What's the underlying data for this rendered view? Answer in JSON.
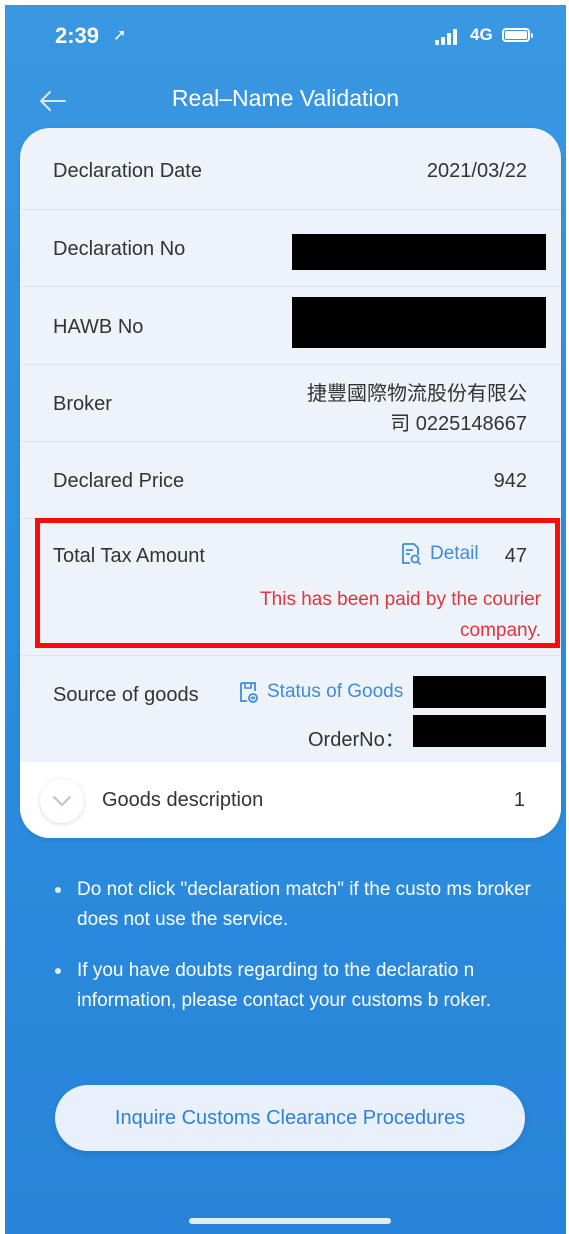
{
  "status_bar": {
    "time": "2:39",
    "network": "4G"
  },
  "header": {
    "title": "Real–Name Validation"
  },
  "details": {
    "declaration_date": {
      "label": "Declaration Date",
      "value": "2021/03/22"
    },
    "declaration_no": {
      "label": "Declaration No"
    },
    "hawb_no": {
      "label": "HAWB No"
    },
    "broker": {
      "label": "Broker",
      "value_line1": "捷豐國際物流股份有限公",
      "value_line2": "司 0225148667"
    },
    "declared_price": {
      "label": "Declared Price",
      "value": "942"
    },
    "total_tax": {
      "label": "Total Tax Amount",
      "detail_link": "Detail",
      "value": "47",
      "note_line1": "This has been paid by the courier",
      "note_line2": "company."
    },
    "source_of_goods": {
      "label": "Source of goods",
      "status_link": "Status of Goods",
      "order_label": "OrderNo："
    },
    "goods_description": {
      "label": "Goods description",
      "count": "1"
    }
  },
  "notes": [
    "Do not click \"declaration match\" if the custo ms broker does not use the service.",
    "If you have doubts regarding to the declaratio n information, please contact your customs b roker."
  ],
  "actions": {
    "inquire_label": "Inquire Customs Clearance Procedures"
  },
  "colors": {
    "accent": "#3d8be0",
    "background": "#2c8ee0",
    "warning": "#e0353c",
    "highlight_border": "#ff0a0a"
  }
}
